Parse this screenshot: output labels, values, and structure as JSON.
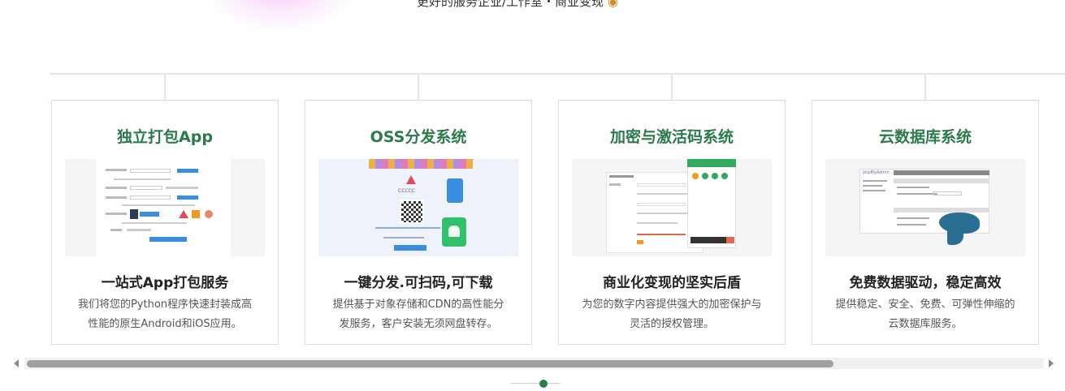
{
  "header": {
    "tagline": "更好的服务企业/工作室・商业变现",
    "tagline_icon": "money-bag-icon"
  },
  "cards": [
    {
      "title": "独立打包App",
      "heading": "一站式App打包服务",
      "desc_line1": "我们将您的Python程序快速封装成高",
      "desc_line2": "性能的原生Android和iOS应用。"
    },
    {
      "title": "OSS分发系统",
      "heading": "一键分发.可扫码,可下载",
      "desc_line1": "提供基于对象存储和CDN的高性能分",
      "desc_line2": "发服务，客户安装无须网盘转存。"
    },
    {
      "title": "加密与激活码系统",
      "heading": "商业化变现的坚实后盾",
      "desc_line1": "为您的数字内容提供强大的加密保护与",
      "desc_line2": "灵活的授权管理。"
    },
    {
      "title": "云数据库系统",
      "heading": "免费数据驱动，稳定高效",
      "desc_line1": "提供稳定、安全、免费、可弹性伸缩的",
      "desc_line2": "云数据库服务。"
    }
  ],
  "oss_logo_text": "CCCCC",
  "db_logo_text": "phpMyAdmin",
  "colors": {
    "accent_green": "#2b7a4b",
    "border": "#dcdcdc",
    "scrollbar_thumb": "#a0a0a0"
  },
  "pager": {
    "active_index": 1
  }
}
